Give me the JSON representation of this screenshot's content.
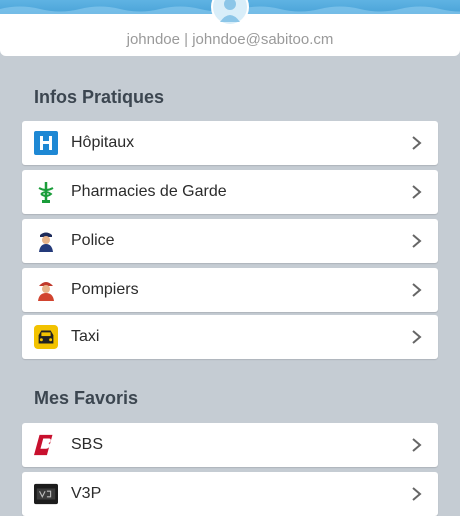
{
  "header": {
    "user_line": "johndoe | johndoe@sabitoo.cm"
  },
  "sections": {
    "infos": {
      "title": "Infos Pratiques",
      "items": [
        {
          "label": "Hôpitaux",
          "icon": "hospital-icon"
        },
        {
          "label": "Pharmacies de Garde",
          "icon": "pharmacy-icon"
        },
        {
          "label": "Police",
          "icon": "police-icon"
        },
        {
          "label": "Pompiers",
          "icon": "firefighter-icon"
        },
        {
          "label": "Taxi",
          "icon": "taxi-icon"
        }
      ]
    },
    "favoris": {
      "title": "Mes Favoris",
      "items": [
        {
          "label": "SBS",
          "icon": "sbs-logo-icon"
        },
        {
          "label": "V3P",
          "icon": "v3p-logo-icon"
        }
      ]
    }
  },
  "colors": {
    "background": "#c5ccd3",
    "banner": "#4aa3d8",
    "hospital": "#1e88d4",
    "taxi": "#f2c200"
  }
}
